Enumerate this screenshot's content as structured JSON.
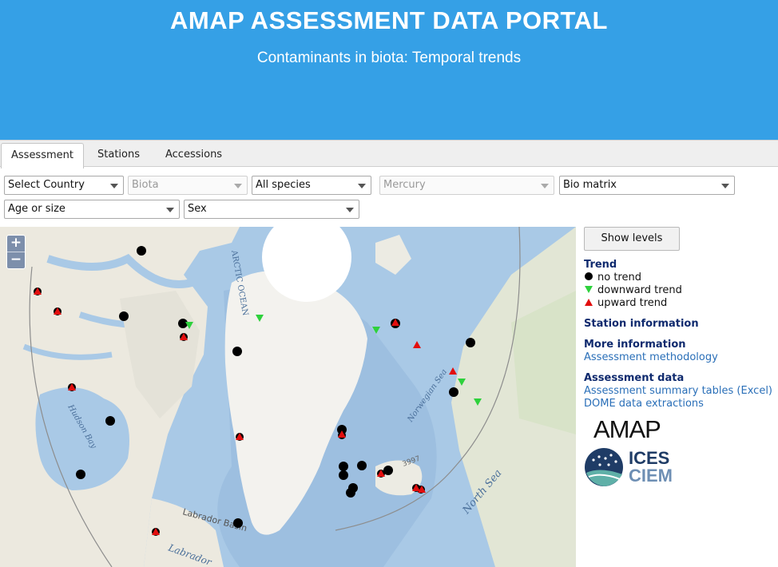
{
  "header": {
    "title": "AMAP ASSESSMENT DATA PORTAL",
    "subtitle": "Contaminants in biota: Temporal trends"
  },
  "tabs": [
    {
      "label": "Assessment",
      "active": true
    },
    {
      "label": "Stations",
      "active": false
    },
    {
      "label": "Accessions",
      "active": false
    }
  ],
  "filters": {
    "country": "Select Country",
    "biota": "Biota",
    "species": "All species",
    "determinand": "Mercury",
    "matrix": "Bio matrix",
    "age": "Age or size",
    "sex": "Sex"
  },
  "map": {
    "zoom_in": "+",
    "zoom_out": "−",
    "labels": {
      "ocean": "ARCTIC OCEAN",
      "hudson": "Hudson Bay",
      "norwegian": "Norwegian Sea",
      "north_sea": "North Sea",
      "labrador_basin": "Labrador Basin",
      "labrador_sea": "Labrador",
      "depth": "3997"
    },
    "colors": {
      "no_trend": "#000000",
      "downward": "#2ed13c",
      "upward": "#e20e0e"
    }
  },
  "sidebar": {
    "show_levels": "Show levels",
    "trend_title": "Trend",
    "legend": {
      "none": "no trend",
      "down": "downward trend",
      "up": "upward trend"
    },
    "station_info": "Station information",
    "more_info": "More information",
    "methodology": "Assessment methodology",
    "assessment_data": "Assessment data",
    "summary_tables": "Assessment summary tables (Excel)",
    "dome": "DOME data extractions",
    "logo_amap": "AMAP",
    "logo_ices": "ICES",
    "logo_ciem": "CIEM"
  }
}
